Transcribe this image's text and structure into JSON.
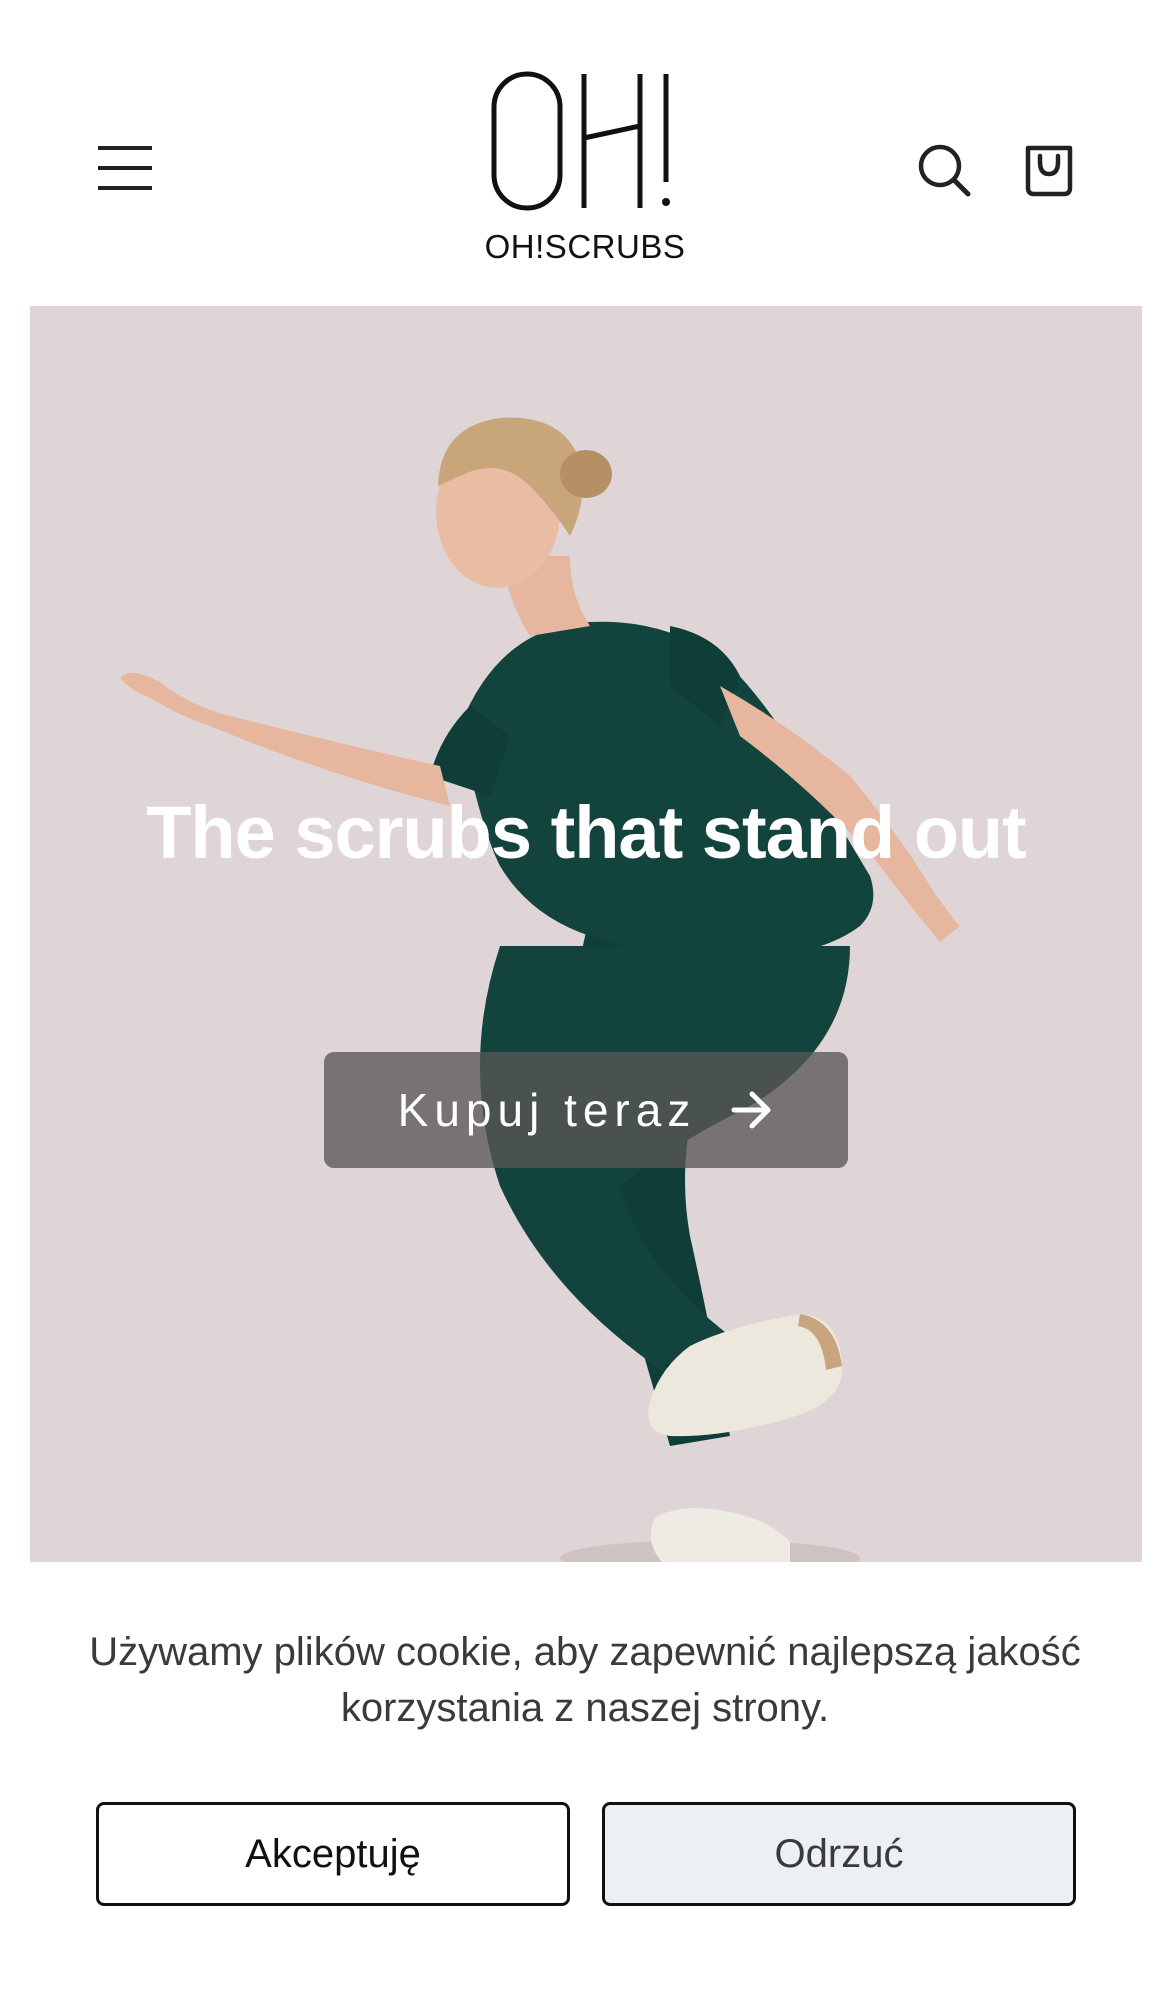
{
  "header": {
    "logo_mark": "OH!",
    "logo_wordmark": "OH!SCRUBS",
    "menu_icon": "hamburger-menu-icon",
    "search_icon": "search-icon",
    "cart_icon": "shopping-bag-icon"
  },
  "hero": {
    "title": "The scrubs that stand out",
    "cta_label": "Kupuj teraz",
    "cta_icon": "arrow-right-icon",
    "background_color": "#dfd5d6",
    "scrubs_color": "#0f3d37"
  },
  "cookie_banner": {
    "message": "Używamy plików cookie, aby zapewnić najlepszą jakość korzystania z naszej strony.",
    "accept_label": "Akceptuję",
    "reject_label": "Odrzuć"
  }
}
